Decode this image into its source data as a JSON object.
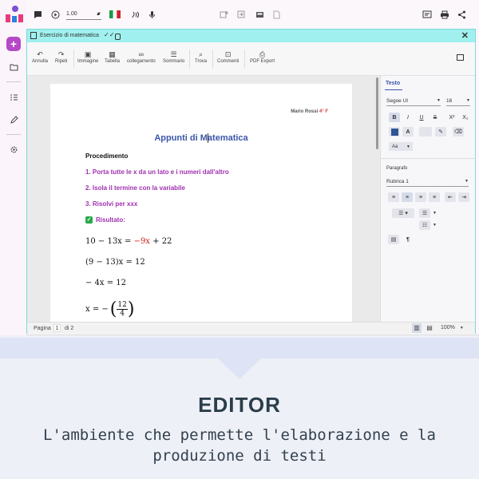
{
  "topbar": {
    "speed_value": "1.00"
  },
  "window": {
    "title": "Esercizio di matematica"
  },
  "ribbon": {
    "items": [
      {
        "label": "Annulla"
      },
      {
        "label": "Ripeti"
      },
      {
        "label": "Immagine"
      },
      {
        "label": "Tabella"
      },
      {
        "label": "collegamento"
      },
      {
        "label": "Sommario"
      },
      {
        "label": "Trova"
      },
      {
        "label": "Commenti"
      },
      {
        "label": "PDF Export"
      }
    ]
  },
  "document": {
    "author": "Mario Rossi",
    "class": "4° F",
    "title": "Appunti di Matematica",
    "heading": "Procedimento",
    "steps": [
      "1. Porta tutte le x da un lato e i numeri dall'altro",
      "2. Isola il termine con la variabile",
      "3. Risolvi per xxx"
    ],
    "result_label": "Risultato:",
    "eq1_left": "10 − 13x = ",
    "eq1_red": "−9x",
    "eq1_right": " + 22",
    "eq2": "(9 − 13)x = 12",
    "eq3": "− 4x = 12",
    "eq4_left": "x = −",
    "eq4_num": "12",
    "eq4_den": "4"
  },
  "side": {
    "tab": "Testo",
    "font_name": "Segoe UI",
    "font_size": "16",
    "bold": "B",
    "italic": "I",
    "underline": "U",
    "strike": "S",
    "superscript": "X²",
    "subscript": "X₂",
    "font_color_letter": "A",
    "case_label": "Aa",
    "paragraph_label": "Paragrafo",
    "paragraph_style": "Rubrica 1",
    "pilcrow": "¶"
  },
  "status": {
    "page_label": "Pagina",
    "page_current": "1",
    "page_of": "di 2",
    "zoom": "100%"
  },
  "caption": {
    "title": "EDITOR",
    "subtitle": "L'ambiente che permette l'elaborazione e la produzione di testi"
  },
  "colors": {
    "accent_purple": "#b548c6",
    "title_blue": "#3a56a8",
    "step_purple": "#a030b0",
    "titlebar_teal": "#9ff0ee",
    "color_swatch": "#2f5596",
    "result_green": "#2aa84a"
  }
}
